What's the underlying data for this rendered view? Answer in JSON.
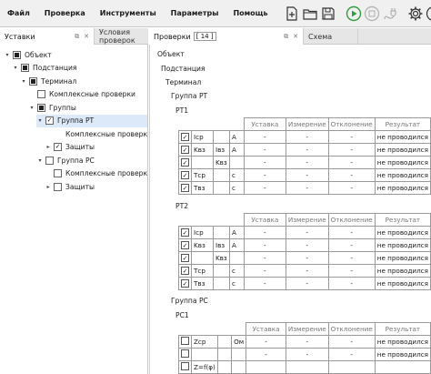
{
  "menu": [
    "Файл",
    "Проверка",
    "Инструменты",
    "Параметры",
    "Помощь"
  ],
  "toolbar": {
    "icons": [
      "new-file-icon",
      "open-folder-icon",
      "save-icon",
      "play-icon",
      "stop-icon",
      "plug-icon",
      "gear-icon",
      "info-icon"
    ],
    "colors": {
      "play": "#2e9e3e",
      "stop": "#b8b8b8"
    }
  },
  "left_tabs": [
    {
      "label": "Уставки"
    },
    {
      "label": "Условия проверок"
    }
  ],
  "right_tabs": [
    {
      "label": "Проверки",
      "badge": "[ 14 ]"
    },
    {
      "label": "Схема"
    }
  ],
  "tree": [
    {
      "label": "Объект",
      "level": 0,
      "expander": "▾",
      "check": "partial"
    },
    {
      "label": "Подстанция",
      "level": 1,
      "expander": "▾",
      "check": "partial"
    },
    {
      "label": "Терминал",
      "level": 2,
      "expander": "▾",
      "check": "partial"
    },
    {
      "label": "Комплексные проверки",
      "level": 3,
      "expander": "",
      "check": "empty"
    },
    {
      "label": "Группы",
      "level": 3,
      "expander": "▾",
      "check": "partial"
    },
    {
      "label": "Группа РТ",
      "level": 4,
      "expander": "▾",
      "check": "checked",
      "selected": true
    },
    {
      "label": "Комплексные проверки",
      "level": 5,
      "expander": "",
      "check": "none"
    },
    {
      "label": "Защиты",
      "level": 5,
      "expander": "▸",
      "check": "checked"
    },
    {
      "label": "Группа РС",
      "level": 4,
      "expander": "▾",
      "check": "empty"
    },
    {
      "label": "Комплексные проверки",
      "level": 5,
      "expander": "",
      "check": "empty"
    },
    {
      "label": "Защиты",
      "level": 5,
      "expander": "▸",
      "check": "empty"
    }
  ],
  "report": {
    "object": "Объект",
    "substation": "Подстанция",
    "terminal": "Терминал",
    "group_rt": "Группа РТ",
    "group_rs": "Группа РС",
    "columns": [
      "Уставка",
      "Измерение",
      "Отклонение",
      "Результат"
    ],
    "pt1": {
      "title": "РТ1",
      "rows": [
        {
          "checked": true,
          "name": "Iср",
          "sub": "",
          "unit": "А",
          "set": "-",
          "meas": "-",
          "dev": "-",
          "result": "не проводился"
        },
        {
          "checked": true,
          "name": "Kвз",
          "sub": "Iвз",
          "unit": "А",
          "set": "-",
          "meas": "-",
          "dev": "-",
          "result": "не проводился"
        },
        {
          "checked": true,
          "name": "",
          "sub": "Kвз",
          "unit": "",
          "set": "-",
          "meas": "-",
          "dev": "-",
          "result": "не проводился"
        },
        {
          "checked": true,
          "name": "Tср",
          "sub": "",
          "unit": "с",
          "set": "-",
          "meas": "-",
          "dev": "-",
          "result": "не проводился"
        },
        {
          "checked": true,
          "name": "Tвз",
          "sub": "",
          "unit": "с",
          "set": "-",
          "meas": "-",
          "dev": "-",
          "result": "не проводился"
        }
      ]
    },
    "pt2": {
      "title": "РТ2",
      "rows": [
        {
          "checked": true,
          "name": "Iср",
          "sub": "",
          "unit": "А",
          "set": "-",
          "meas": "-",
          "dev": "-",
          "result": "не проводился"
        },
        {
          "checked": true,
          "name": "Kвз",
          "sub": "Iвз",
          "unit": "А",
          "set": "-",
          "meas": "-",
          "dev": "-",
          "result": "не проводился"
        },
        {
          "checked": true,
          "name": "",
          "sub": "Kвз",
          "unit": "",
          "set": "-",
          "meas": "-",
          "dev": "-",
          "result": "не проводился"
        },
        {
          "checked": true,
          "name": "Tср",
          "sub": "",
          "unit": "с",
          "set": "-",
          "meas": "-",
          "dev": "-",
          "result": "не проводился"
        },
        {
          "checked": true,
          "name": "Tвз",
          "sub": "",
          "unit": "с",
          "set": "-",
          "meas": "-",
          "dev": "-",
          "result": "не проводился"
        }
      ]
    },
    "pc1": {
      "title": "РС1",
      "rows": [
        {
          "checked": false,
          "name": "Zср",
          "sub": "",
          "unit": "Ом",
          "set": "-",
          "meas": "-",
          "dev": "-",
          "result": "не проводился"
        },
        {
          "checked": false,
          "name": "",
          "sub": "",
          "unit": "",
          "set": "-",
          "meas": "-",
          "dev": "-",
          "result": "не проводился"
        },
        {
          "checked": false,
          "name": "Z=f(φ)",
          "sub": "",
          "unit": "",
          "set": "",
          "meas": "",
          "dev": "",
          "result": ""
        }
      ]
    }
  }
}
